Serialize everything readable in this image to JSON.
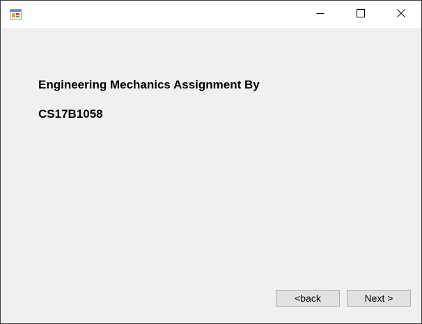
{
  "window": {
    "title": ""
  },
  "icons": {
    "app": "app-form-icon",
    "minimize": "minimize-icon",
    "maximize": "maximize-icon",
    "close": "close-icon"
  },
  "content": {
    "heading_line1": "Engineering Mechanics Assignment By",
    "heading_line2": "CS17B1058"
  },
  "buttons": {
    "back_label": "<back",
    "next_label": "Next >"
  }
}
